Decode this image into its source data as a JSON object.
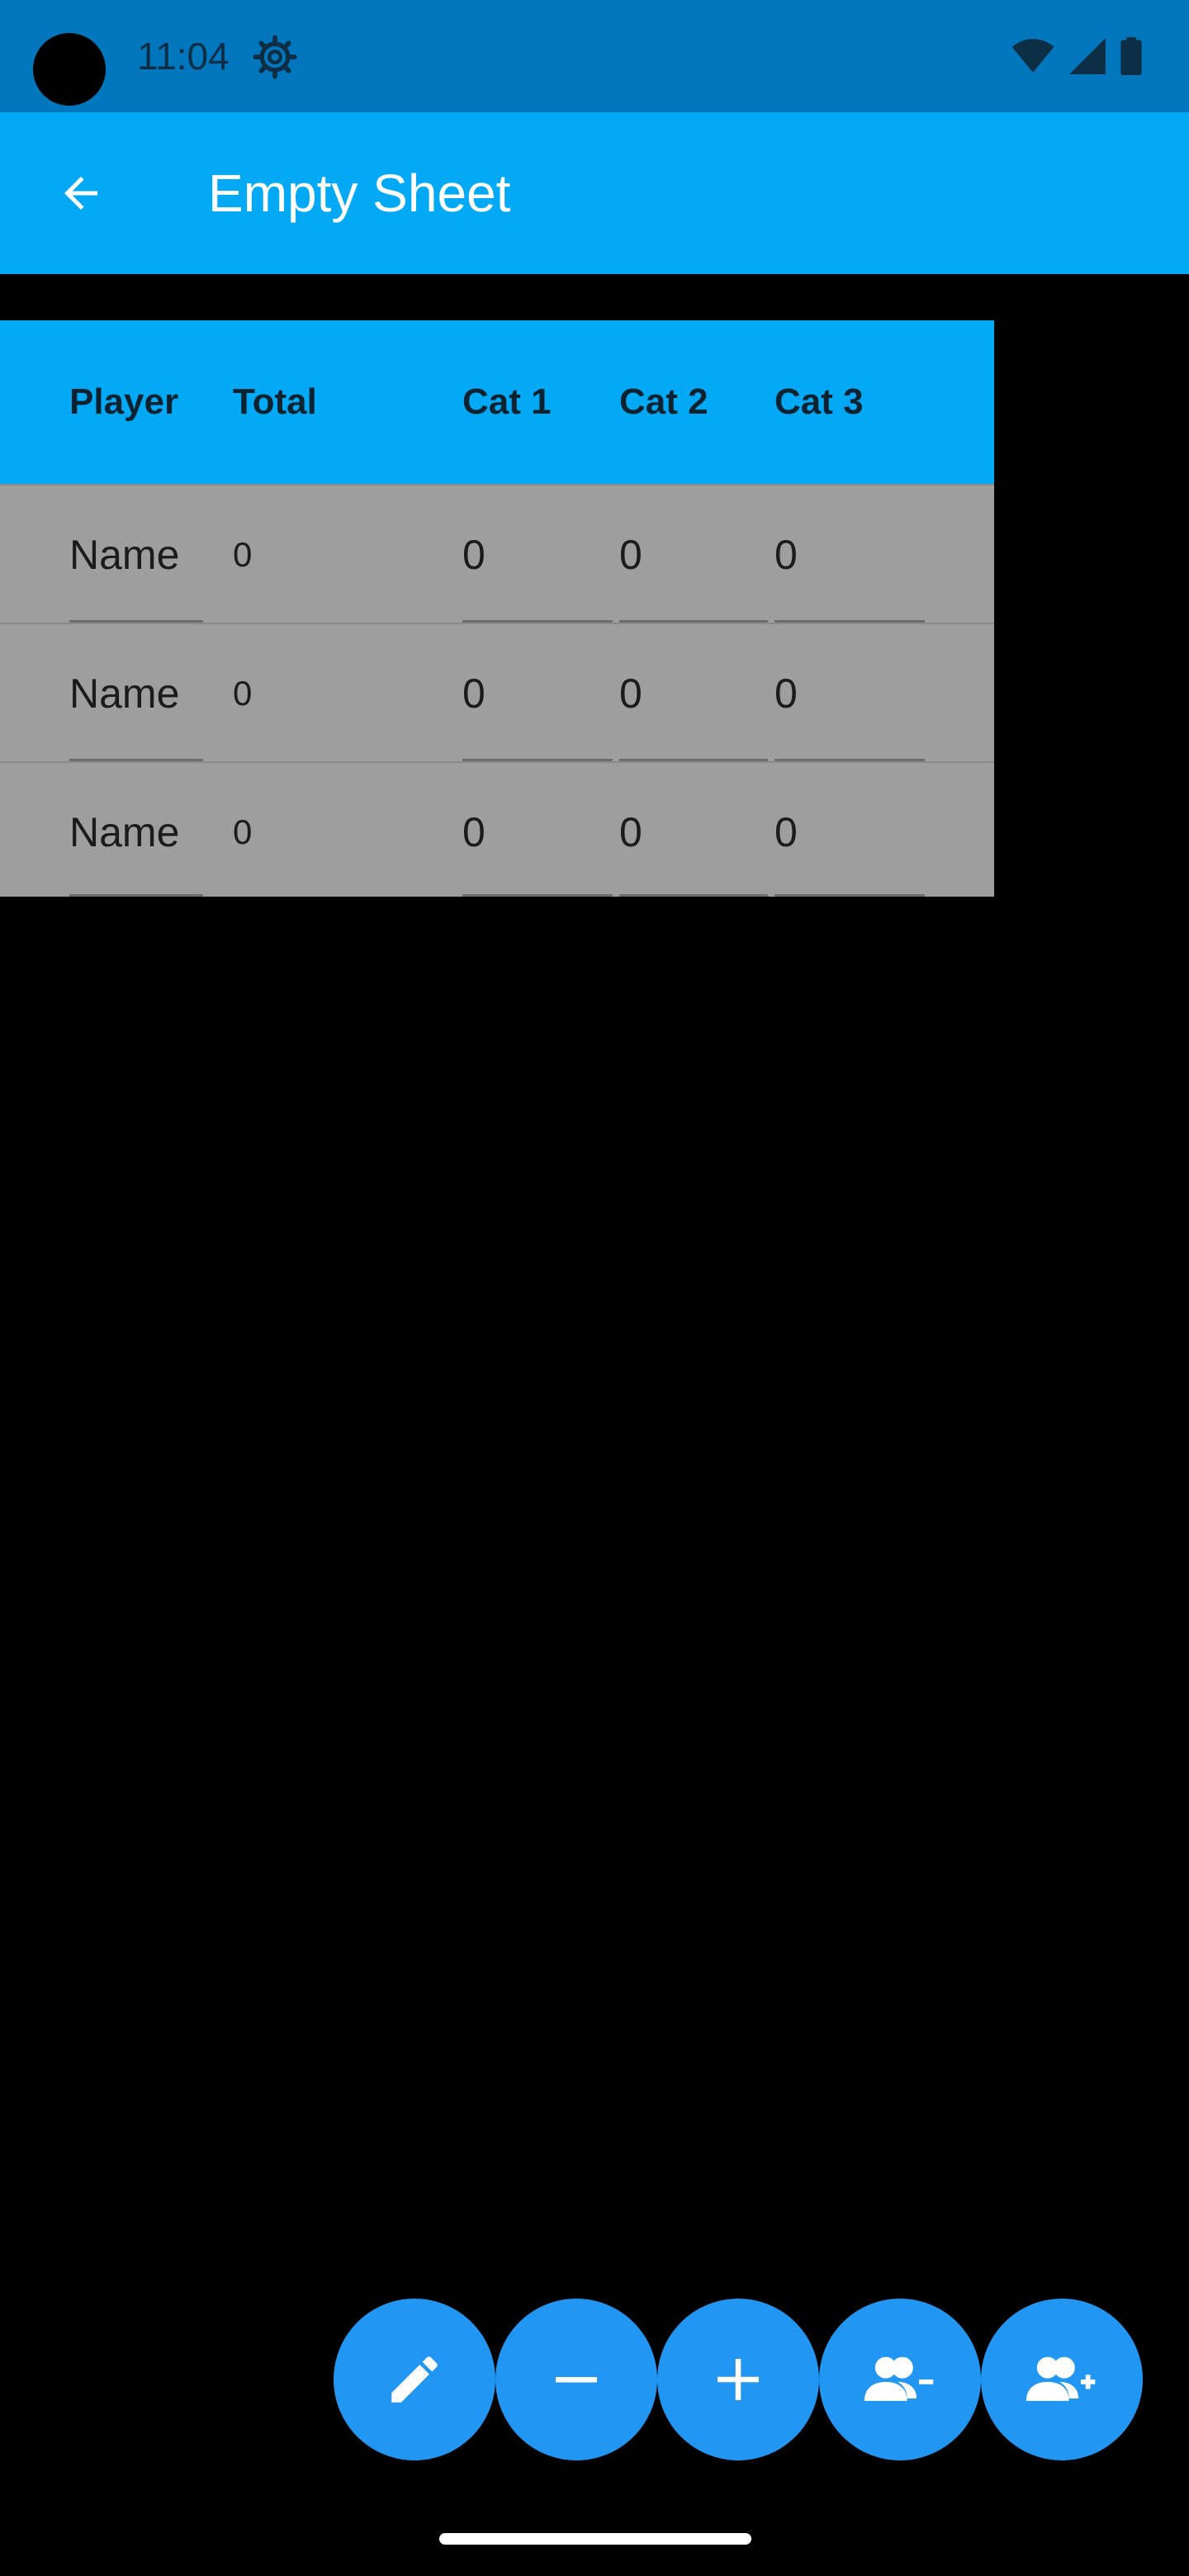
{
  "status_bar": {
    "time": "11:04",
    "icons": [
      "settings-gear-icon",
      "wifi-icon",
      "signal-icon",
      "battery-icon"
    ]
  },
  "app_bar": {
    "title": "Empty Sheet",
    "back_icon": "arrow-left-icon",
    "color": "#03a9f4"
  },
  "table": {
    "headers": [
      "Player",
      "Total",
      "Cat 1",
      "Cat 2",
      "Cat 3"
    ],
    "rows": [
      {
        "name": "Name",
        "total": "0",
        "cat1": "0",
        "cat2": "0",
        "cat3": "0"
      },
      {
        "name": "Name",
        "total": "0",
        "cat1": "0",
        "cat2": "0",
        "cat3": "0"
      },
      {
        "name": "Name",
        "total": "0",
        "cat1": "0",
        "cat2": "0",
        "cat3": "0"
      }
    ]
  },
  "fab_actions": [
    {
      "icon": "pencil-icon"
    },
    {
      "icon": "minus-icon"
    },
    {
      "icon": "plus-icon"
    },
    {
      "icon": "remove-person-icon"
    },
    {
      "icon": "add-person-icon"
    }
  ],
  "colors": {
    "status_bar": "#0277bd",
    "header": "#03a9f4",
    "row": "#9e9e9e",
    "fab": "#2196f3",
    "background": "#000000"
  }
}
